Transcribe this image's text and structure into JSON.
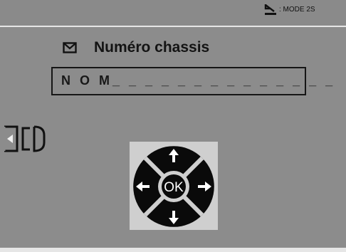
{
  "header": {
    "mode_label": ": MODE 2S",
    "mode_icon": "mode-arrow-icon"
  },
  "title": {
    "icon": "envelope-icon",
    "text": "Numéro chassis"
  },
  "field": {
    "value": "N O M_ _ _ _ _ _ _ _ _ _ _ _ _ _"
  },
  "nav": {
    "back_icon": "back-bracket-icon",
    "ok_label": "OK",
    "up_icon": "arrow-up-icon",
    "down_icon": "arrow-down-icon",
    "left_icon": "arrow-left-icon",
    "right_icon": "arrow-right-icon"
  },
  "colors": {
    "background": "#8c8c8c",
    "text": "#141414",
    "dpad": "#0a0a0a",
    "rule": "#e6e6e6"
  }
}
